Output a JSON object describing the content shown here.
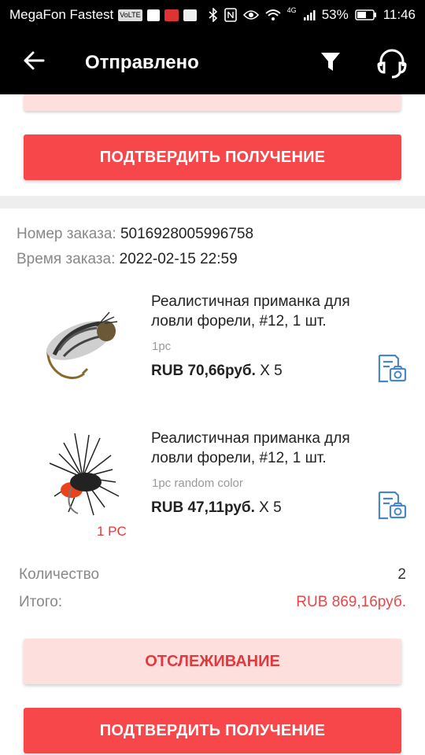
{
  "status_bar": {
    "carrier": "MegaFon Fastest",
    "network": "4G",
    "battery": "53%",
    "time": "11:46"
  },
  "header": {
    "title": "Отправлено",
    "back_icon": "arrow-left-icon",
    "filter_icon": "funnel-icon",
    "support_icon": "headset-icon"
  },
  "top_card": {
    "confirm_label": "ПОДТВЕРДИТЬ ПОЛУЧЕНИЕ"
  },
  "order": {
    "number_label": "Номер заказа:",
    "number": "5016928005996758",
    "time_label": "Время заказа:",
    "time": "2022-02-15 22:59",
    "products": [
      {
        "title": "Реалистичная приманка для ловли форели, #12, 1 шт.",
        "variant": "1pc",
        "price": "RUB 70,66руб.",
        "qty": "X 5",
        "image": "fly-lure-nymph-image"
      },
      {
        "title": "Реалистичная приманка для ловли форели, #12, 1 шт.",
        "variant": "1pc random color",
        "price": "RUB 47,11руб.",
        "qty": "X 5",
        "image": "fly-lure-hackle-image",
        "image_caption": "1 PC"
      }
    ],
    "quantity_label": "Количество",
    "quantity": "2",
    "total_label": "Итого:",
    "total": "RUB 869,16руб.",
    "track_label": "ОТСЛЕЖИВАНИЕ",
    "confirm_label": "ПОДТВЕРДИТЬ ПОЛУЧЕНИЕ"
  },
  "colors": {
    "primary_red": "#f8474a",
    "light_pink": "#fde0de",
    "price_red": "#e8474a",
    "icon_blue": "#4a86c5"
  }
}
